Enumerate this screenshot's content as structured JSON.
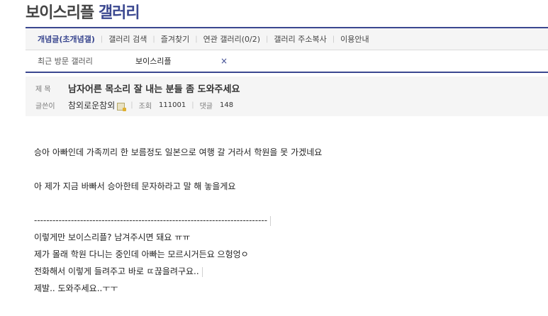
{
  "gallery": {
    "name": "보이스리플",
    "suffix": "갤러리"
  },
  "nav": {
    "items": [
      "개념글(초개념갤)",
      "갤러리 검색",
      "즐겨찾기",
      "연관 갤러리(0/2)",
      "갤러리 주소복사",
      "이용안내"
    ]
  },
  "visited": {
    "label": "최근 방문 갤러리",
    "gallery": "보이스리플",
    "close": "×"
  },
  "post": {
    "subject_label": "제 목",
    "subject": "남자어른 목소리 잘 내는 분들 좀 도와주세요",
    "author_label": "글쓴이",
    "author": "참외로운참외",
    "views_label": "조회",
    "views": "111001",
    "comments_label": "댓글",
    "comments": "148"
  },
  "body": {
    "lines": [
      "승아 아빠인데 가족끼리 한 보름정도 일본으로 여행 갈 거라서 학원을 못 가겠네요",
      "아 제가 지금 바빠서 승아한테 문자하라고 말 해 놓을게요",
      "----------------------------------------------------------------------------",
      "이렇게만 보이스리플? 남겨주시면 돼요 ㅠㅠ",
      "제가 몰래 학원 다니는 중인데 아빠는 모르시거든요 으헝엉ㅇ",
      "전화해서 이렇게 들려주고 바로 ㄸ끊을려구요..",
      "제발.. 도와주세요..ㅜㅜ"
    ]
  },
  "colors": {
    "accent": "#3b4890"
  }
}
